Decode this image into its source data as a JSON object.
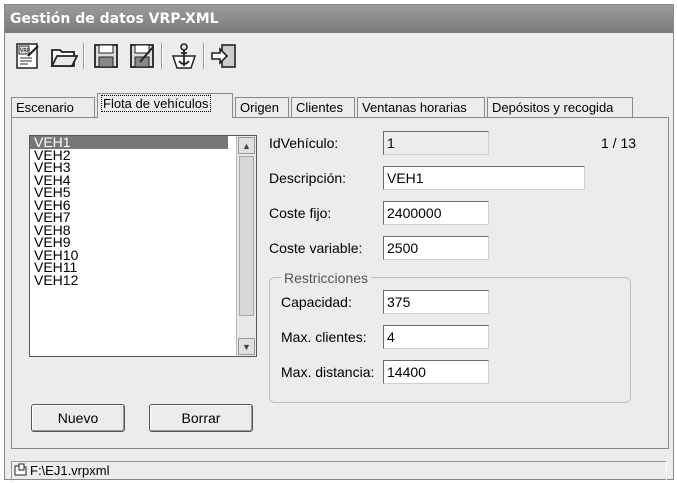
{
  "window": {
    "title": "Gestión de datos VRP-XML"
  },
  "toolbar": {
    "buttons": [
      {
        "icon": "new-xml-icon"
      },
      {
        "icon": "open-folder-icon"
      },
      {
        "icon": "save-icon"
      },
      {
        "icon": "save-as-icon"
      },
      {
        "icon": "anchor-icon"
      },
      {
        "icon": "exit-icon"
      }
    ]
  },
  "tabs": [
    {
      "label": "Escenario"
    },
    {
      "label": "Flota de vehículos"
    },
    {
      "label": "Origen"
    },
    {
      "label": "Clientes"
    },
    {
      "label": "Ventanas horarias"
    },
    {
      "label": "Depósitos y recogida"
    }
  ],
  "vehicles": {
    "items": [
      "VEH1",
      "VEH2",
      "VEH3",
      "VEH4",
      "VEH5",
      "VEH6",
      "VEH7",
      "VEH8",
      "VEH9",
      "VEH10",
      "VEH11",
      "VEH12"
    ],
    "selected": "VEH1"
  },
  "form": {
    "id_label": "IdVehículo:",
    "id_value": "1",
    "counter": "1 / 13",
    "description_label": "Descripción:",
    "description_value": "VEH1",
    "fixed_cost_label": "Coste fijo:",
    "fixed_cost_value": "2400000",
    "variable_cost_label": "Coste variable:",
    "variable_cost_value": "2500",
    "restrictions_title": "Restricciones",
    "capacity_label": "Capacidad:",
    "capacity_value": "375",
    "max_clients_label": "Max. clientes:",
    "max_clients_value": "4",
    "max_distance_label": "Max. distancia:",
    "max_distance_value": "14400"
  },
  "buttons": {
    "new_label": "Nuevo",
    "delete_label": "Borrar"
  },
  "status": {
    "file_path": "F:\\EJ1.vrpxml"
  }
}
